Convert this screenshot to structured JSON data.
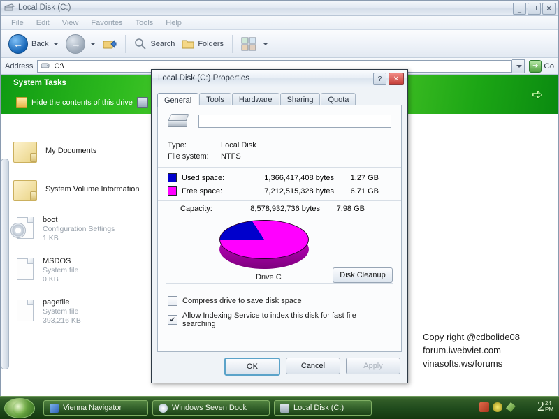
{
  "window": {
    "title": "Local Disk (C:)",
    "icon": "drive-icon",
    "controls": {
      "minimize": "_",
      "maximize": "❐",
      "close": "✕"
    },
    "menus": [
      "File",
      "Edit",
      "View",
      "Favorites",
      "Tools",
      "Help"
    ],
    "toolbar": {
      "back_label": "Back",
      "search_label": "Search",
      "folders_label": "Folders",
      "views_label": "Views"
    },
    "address": {
      "label": "Address",
      "value": "C:\\",
      "go_label": "Go"
    }
  },
  "sidebar": {
    "panel_title": "System Tasks",
    "link_label": "Hide the contents of this drive",
    "items": [
      {
        "name": "My Documents",
        "type": "",
        "size": ""
      },
      {
        "name": "System Volume Information",
        "type": "",
        "size": ""
      },
      {
        "name": "boot",
        "type": "Configuration Settings",
        "size": "1 KB"
      },
      {
        "name": "MSDOS",
        "type": "System file",
        "size": "0 KB"
      },
      {
        "name": "pagefile",
        "type": "System file",
        "size": "393,216 KB"
      }
    ]
  },
  "watermark": {
    "line1": "Copy right @cdbolide08",
    "line2": "forum.iwebviet.com",
    "line3": "vinasofts.ws/forums"
  },
  "dialog": {
    "title": "Local Disk (C:) Properties",
    "help_label": "?",
    "close_label": "✕",
    "tabs": [
      {
        "label": "General",
        "active": true
      },
      {
        "label": "Tools",
        "active": false
      },
      {
        "label": "Hardware",
        "active": false
      },
      {
        "label": "Sharing",
        "active": false
      },
      {
        "label": "Quota",
        "active": false
      }
    ],
    "volume_label_value": "",
    "volume_label_placeholder": "",
    "type_key": "Type:",
    "type_value": "Local Disk",
    "fs_key": "File system:",
    "fs_value": "NTFS",
    "used": {
      "label": "Used space:",
      "bytes": "1,366,417,408 bytes",
      "gb": "1.27 GB",
      "color": "#0000cc"
    },
    "free": {
      "label": "Free space:",
      "bytes": "7,212,515,328 bytes",
      "gb": "6.71 GB",
      "color": "#ff00ff"
    },
    "capacity": {
      "label": "Capacity:",
      "bytes": "8,578,932,736 bytes",
      "gb": "7.98 GB"
    },
    "pie_caption": "Drive C",
    "disk_cleanup_label": "Disk Cleanup",
    "compress_label": "Compress drive to save disk space",
    "compress_checked": false,
    "index_label": "Allow Indexing Service to index this disk for fast file searching",
    "index_checked": true,
    "index_check_glyph": "✔",
    "ok_label": "OK",
    "cancel_label": "Cancel",
    "apply_label": "Apply"
  },
  "chart_data": {
    "type": "pie",
    "title": "Drive C",
    "categories": [
      "Used space",
      "Free space"
    ],
    "values": [
      1366417408,
      7212515328
    ],
    "value_labels": [
      "1.27 GB",
      "6.71 GB"
    ],
    "percentages": [
      15.9,
      84.1
    ],
    "colors": [
      "#0000cc",
      "#ff00ff"
    ],
    "total": 8578932736,
    "total_label": "7.98 GB",
    "units": "bytes",
    "legend": "left",
    "three_d": true
  },
  "taskbar": {
    "start_label": "",
    "tasks": [
      {
        "label": "Vienna Navigator",
        "color": "#4a7fd4"
      },
      {
        "label": "Windows Seven Dock",
        "color": "#cfe0ee"
      },
      {
        "label": "Local Disk (C:)",
        "color": "#c3ccd6"
      }
    ],
    "tray": [
      "#c85a3a",
      "#d8c83a",
      "#8fc94a"
    ],
    "clock": {
      "hour": "2",
      "minute": "24",
      "meridiem": "PM"
    }
  }
}
